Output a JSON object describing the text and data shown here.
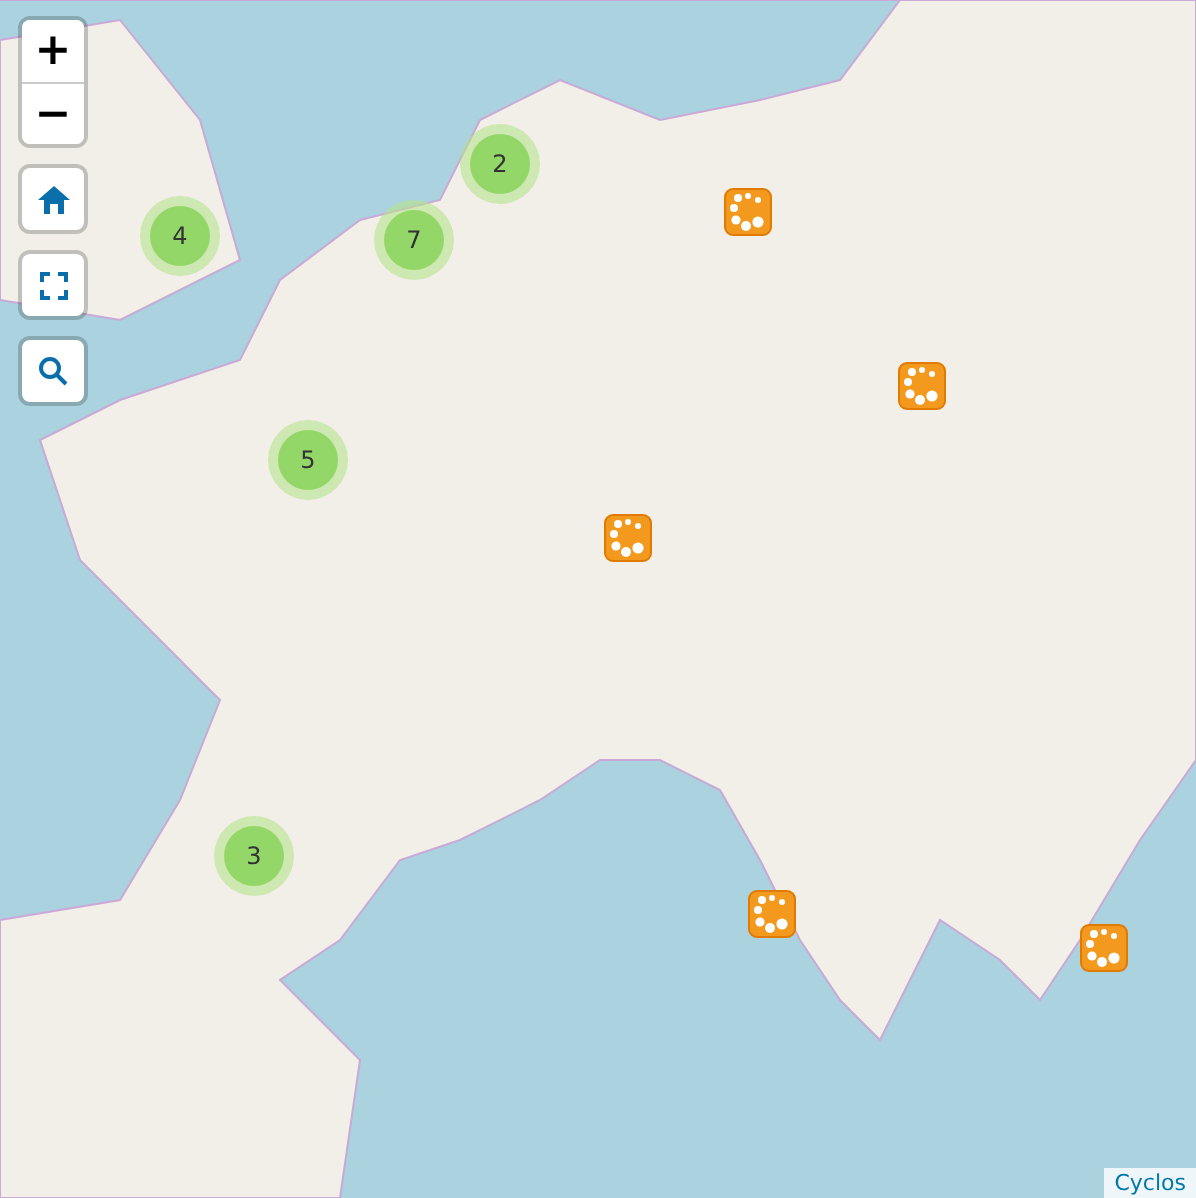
{
  "zoom_controls": {
    "zoom_in": "+",
    "zoom_out": "−"
  },
  "clusters": [
    {
      "count": "4"
    },
    {
      "count": "2"
    },
    {
      "count": "7"
    },
    {
      "count": "5"
    },
    {
      "count": "3"
    }
  ],
  "markers": [
    {
      "kind": "store"
    },
    {
      "kind": "store"
    },
    {
      "kind": "store"
    },
    {
      "kind": "store"
    },
    {
      "kind": "store"
    }
  ],
  "attribution": "Cyclos"
}
